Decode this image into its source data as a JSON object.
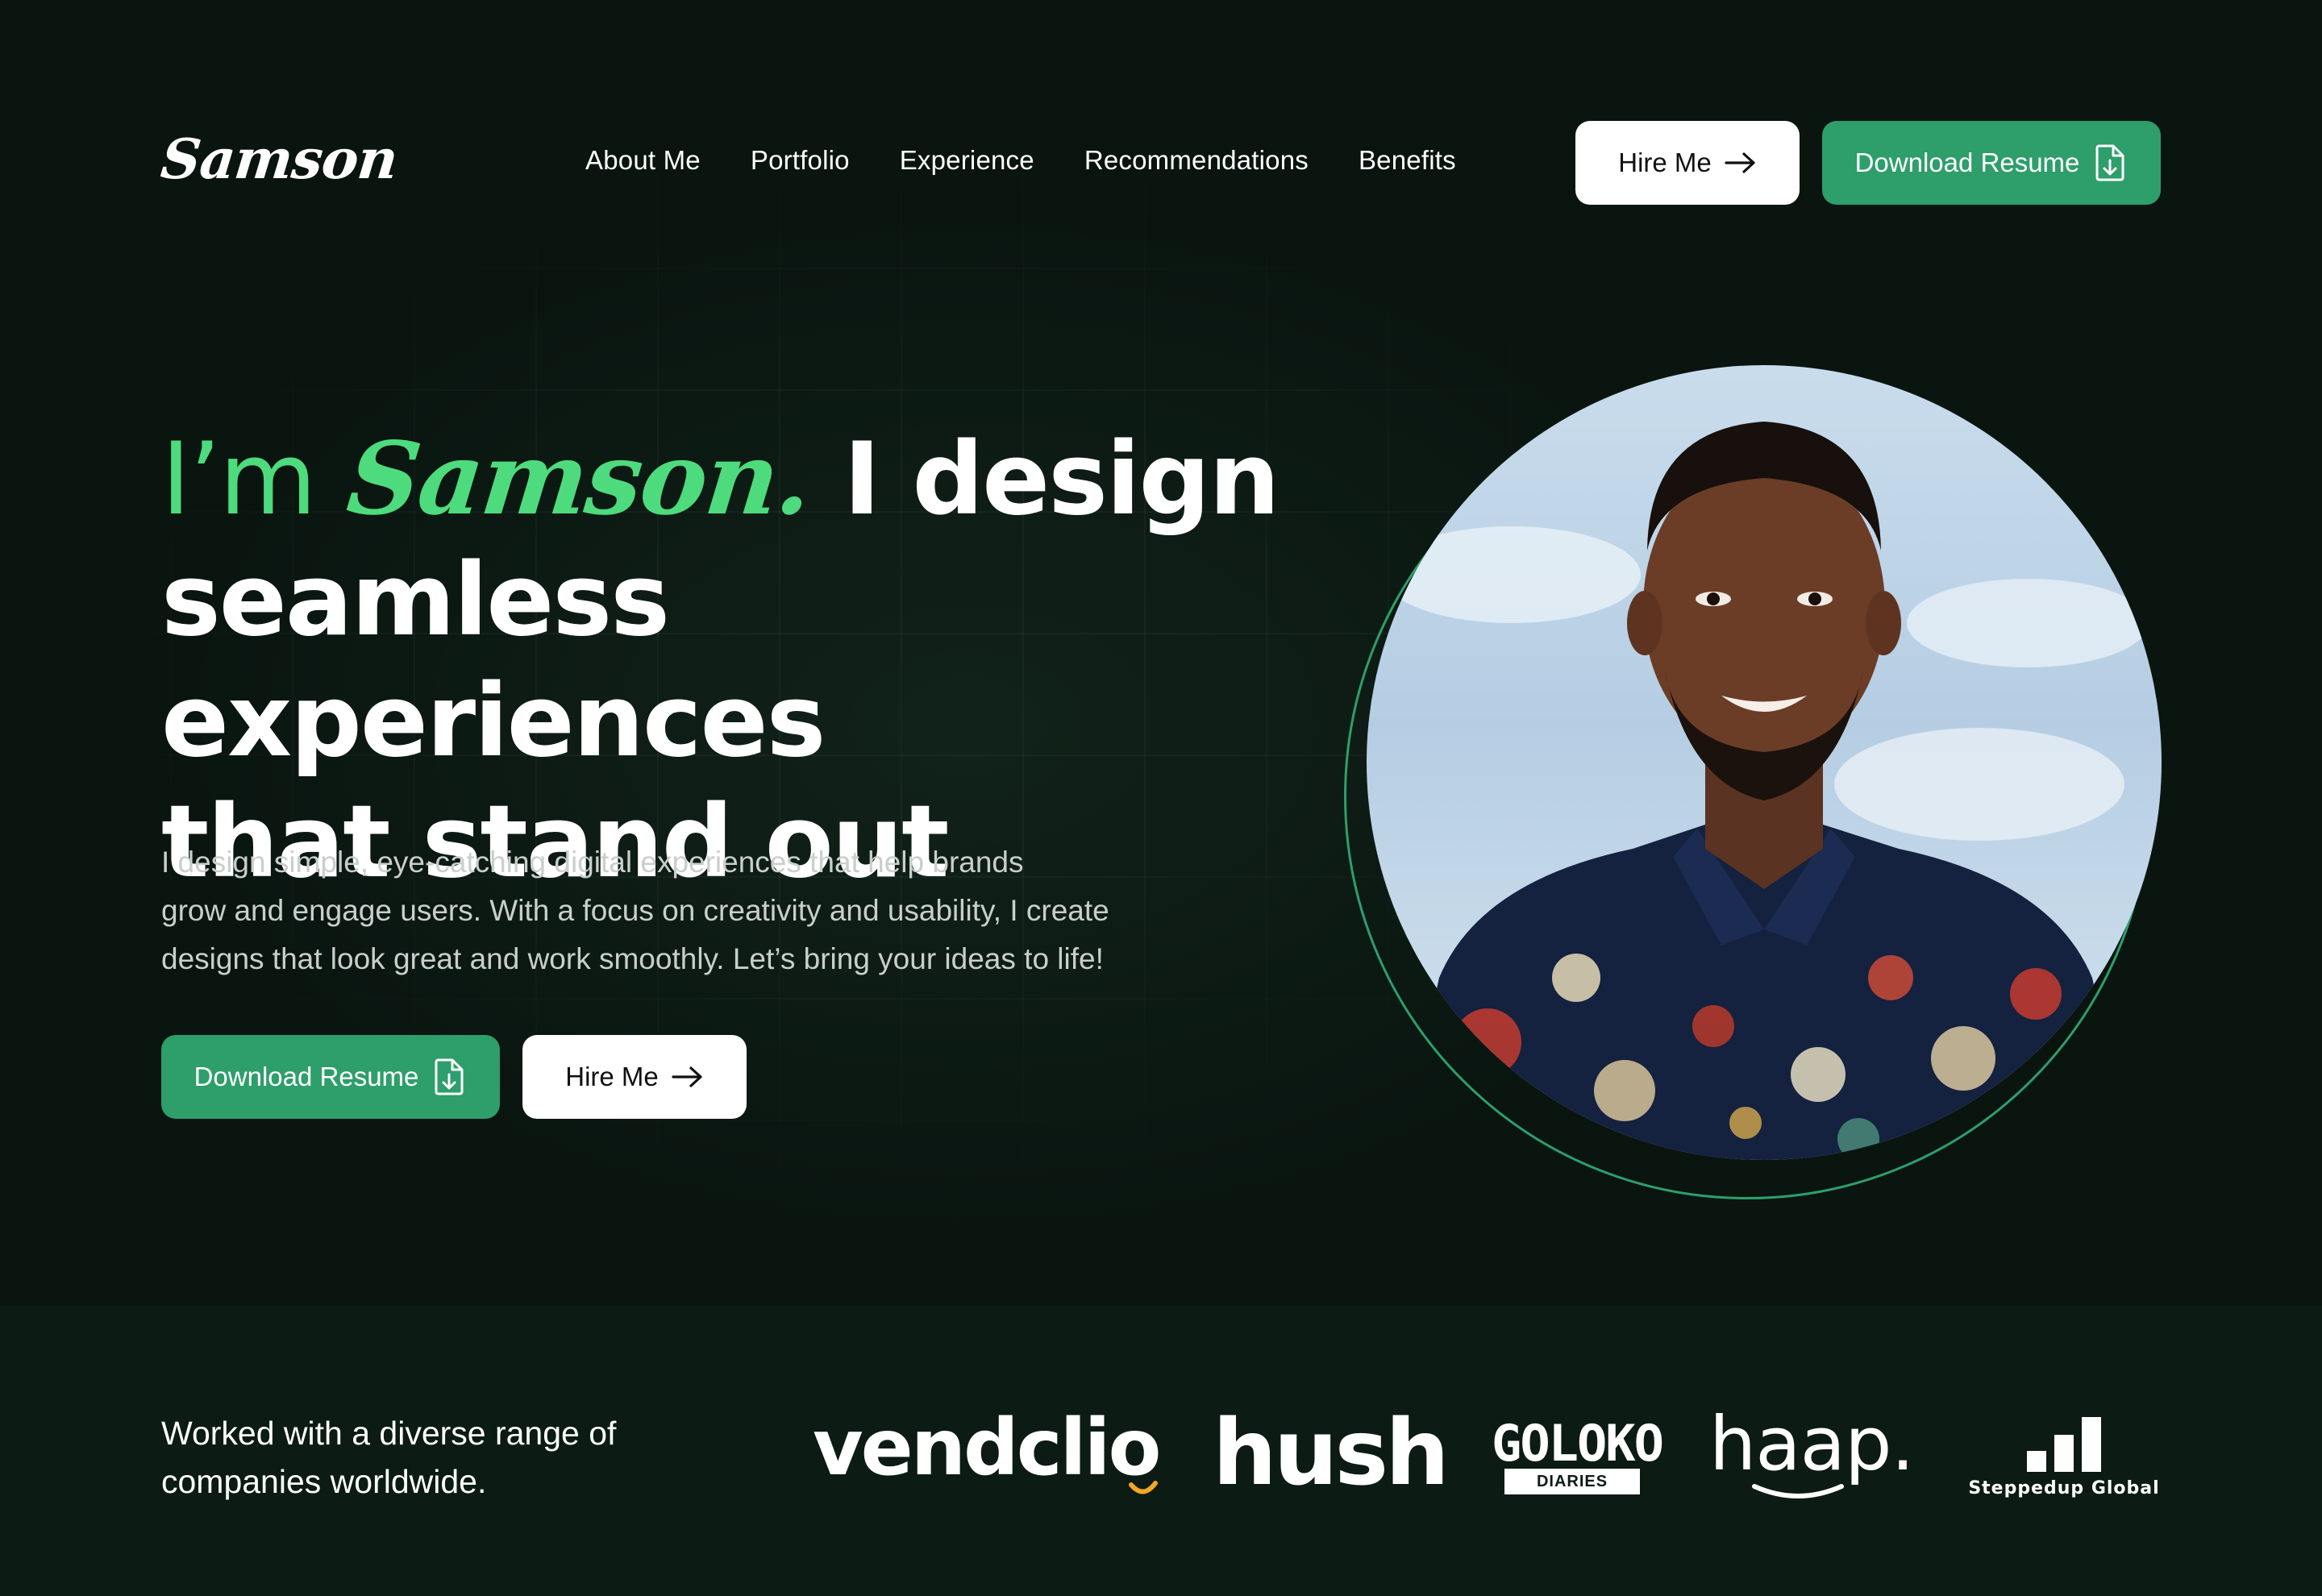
{
  "header": {
    "logo": "Samson",
    "nav": [
      "About Me",
      "Portfolio",
      "Experience",
      "Recommendations",
      "Benefits"
    ],
    "hire_label": "Hire Me",
    "download_label": "Download Resume"
  },
  "hero": {
    "im": "I’m",
    "name": "Samson.",
    "line1_rest": "I design",
    "line2": "seamless experiences",
    "line3": "that stand out",
    "subtitle_lines": [
      "I design simple, eye-catching digital experiences that help brands",
      "grow and engage users. With a focus on creativity and usability, I create",
      "designs that look great and work smoothly. Let’s bring your ideas to life!"
    ],
    "download_label": "Download Resume",
    "hire_label": "Hire Me"
  },
  "clients": {
    "caption_lines": [
      "Worked with a diverse range of",
      "companies worldwide."
    ],
    "logos": [
      "vendclio",
      "hush",
      "GOLOKO",
      "DIARIES",
      "haap.",
      "Steppedup Global"
    ]
  },
  "colors": {
    "accent": "#4ddb7d",
    "button_green": "#2e9e6b",
    "background": "#0a1510"
  },
  "icons": [
    "arrow-right-icon",
    "download-file-icon"
  ]
}
